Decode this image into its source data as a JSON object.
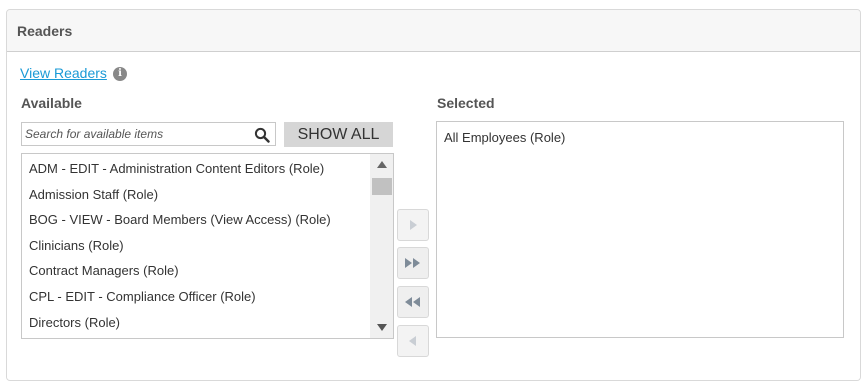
{
  "panel": {
    "title": "Readers"
  },
  "readers_link": {
    "label": "View Readers",
    "info_icon": "info-icon"
  },
  "available": {
    "title": "Available",
    "search_placeholder": "Search for available items",
    "search_value": "",
    "show_all_label": "SHOW ALL",
    "items": [
      "ADM - EDIT - Administration Content Editors (Role)",
      "Admission Staff (Role)",
      "BOG - VIEW - Board Members (View Access) (Role)",
      "Clinicians (Role)",
      "Contract Managers (Role)",
      "CPL - EDIT - Compliance Officer (Role)",
      "Directors (Role)"
    ]
  },
  "transfer_buttons": [
    {
      "name": "move-right-button",
      "icon": "arrow-right-icon",
      "enabled": false
    },
    {
      "name": "move-all-right-button",
      "icon": "double-arrow-right-icon",
      "enabled": true
    },
    {
      "name": "move-all-left-button",
      "icon": "double-arrow-left-icon",
      "enabled": true
    },
    {
      "name": "move-left-button",
      "icon": "arrow-left-icon",
      "enabled": false
    }
  ],
  "selected": {
    "title": "Selected",
    "items": [
      "All Employees (Role)"
    ]
  },
  "colors": {
    "link": "#1a9ad6",
    "panel_bg": "#f7f7f7",
    "border": "#c8c8c8",
    "button_bg": "#d6d6d6",
    "arrow_enabled": "#7f8c99",
    "arrow_disabled": "#c9ced4"
  }
}
